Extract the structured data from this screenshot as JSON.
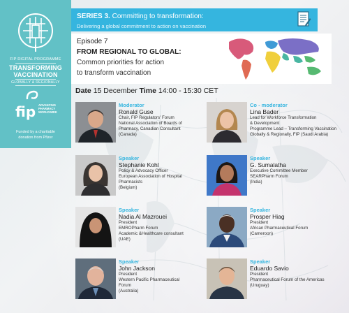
{
  "program": {
    "digital": "FIP DIGITAL PROGRAMME",
    "title_line1": "TRANSFORMING",
    "title_line2": "VACCINATION",
    "tagline": "GLOBALLY & REGIONALLY",
    "fip": "fip",
    "fip_sub": "ADVANCING PHARMACY WORLDWIDE",
    "funded_line1": "Funded by a charitable",
    "funded_line2": "donation from Pfizer"
  },
  "series": {
    "label": "SERIES 3.",
    "title": "Committing to transformation:",
    "subtitle": "Delivering a global commitment to action on vaccination"
  },
  "episode": {
    "number": "Episode 7",
    "title": "FROM REGIONAL TO GLOBAL:",
    "subtitle1": "Common priorities for action",
    "subtitle2": "to transform vaccination"
  },
  "schedule": {
    "date_label": "Date",
    "date": "15 December",
    "time_label": "Time",
    "time": "14:00 - 15:30 CET"
  },
  "speakers": [
    {
      "role": "Moderator",
      "name": "Ronald Guse",
      "details": [
        "Chair, FIP Regulators' Forum",
        "National Association of Boards of",
        "Pharmacy, Canadian Consultant",
        "(Canada)"
      ]
    },
    {
      "role": "Co - moderator",
      "name": "Lina Bader",
      "details": [
        "Lead for Workforce Transformation",
        "& Development",
        "Programme Lead – Transforming Vaccination",
        "Globally & Regionally, FIP (Saudi Arabia)"
      ]
    },
    {
      "role": "Speaker",
      "name": "Stephanie Kohl",
      "details": [
        "Policy & Advocacy Officer",
        "European Association of Hospital",
        "Pharmacists",
        "(Belgium)"
      ]
    },
    {
      "role": "Speaker",
      "name": "G. Sumalatha",
      "details": [
        "Executive Committee Member",
        "SEARPharm Forum",
        "(India)"
      ]
    },
    {
      "role": "Speaker",
      "name": "Nadia Al Mazrouei",
      "details": [
        "President",
        "EMROPharm Forum",
        "Academic &Healthcare consultant",
        "(UAE)"
      ]
    },
    {
      "role": "Speaker",
      "name": "Prosper Hiag",
      "details": [
        "President",
        "African Pharmaceutical Forum",
        "(Cameroon)"
      ]
    },
    {
      "role": "Speaker",
      "name": "John Jackson",
      "details": [
        "President",
        "Western Pacific Pharmaceutical",
        "Forum",
        "(Australia)"
      ]
    },
    {
      "role": "Speaker",
      "name": "Eduardo Savio",
      "details": [
        "President",
        "Pharmaceutical Forum of the Americas",
        "(Uruguay)"
      ]
    }
  ],
  "colors": {
    "teal_panel": "#62c1c6",
    "series_blue": "#35b5df",
    "role_blue": "#35b5df"
  }
}
